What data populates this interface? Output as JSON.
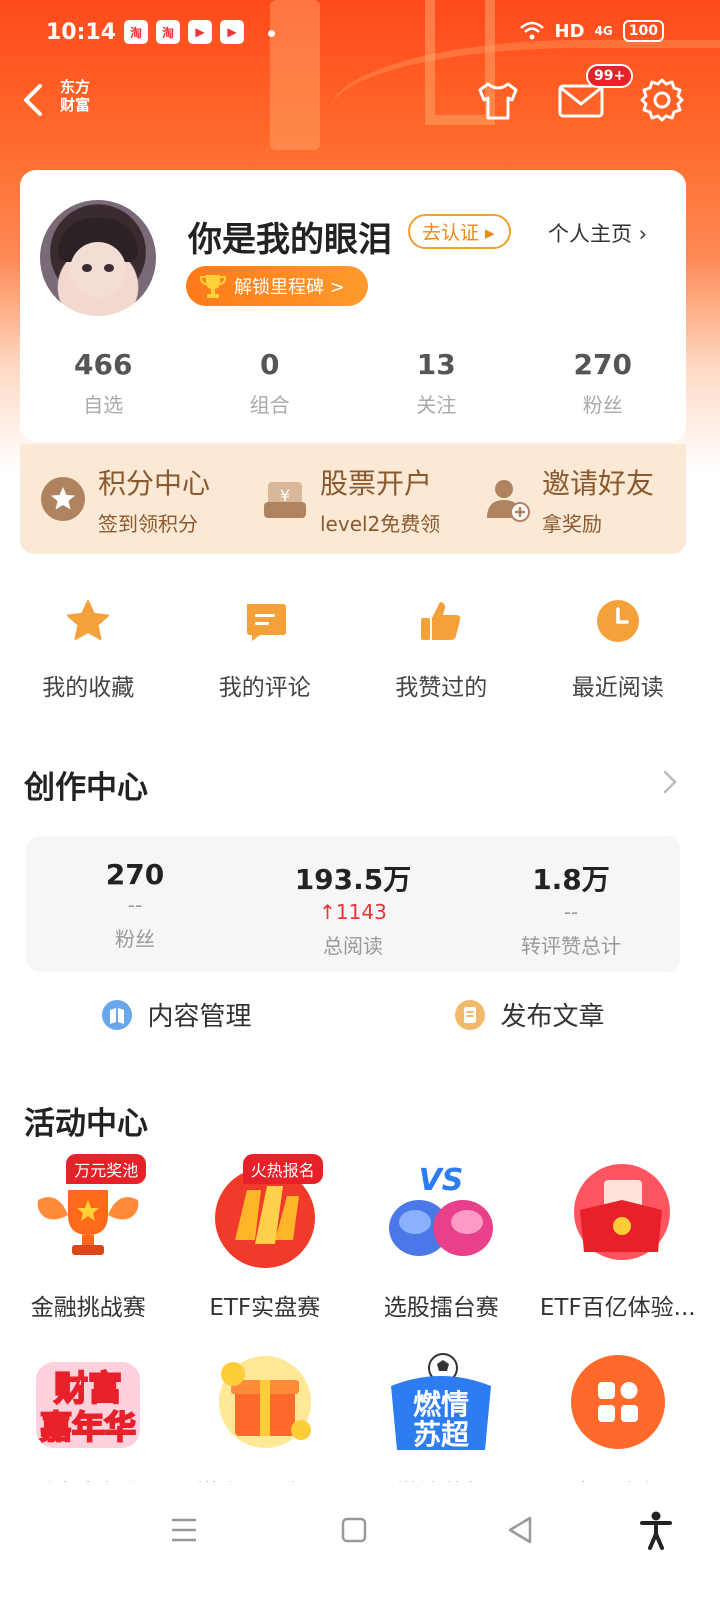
{
  "status_bar": {
    "time": "10:14",
    "app_icons": [
      "淘",
      "淘",
      "▶",
      "▶"
    ],
    "network": "HD",
    "signal": "4G",
    "battery": "100"
  },
  "nav": {
    "brand_line1": "东方",
    "brand_line2": "财富",
    "mail_badge": "99+"
  },
  "profile": {
    "username": "你是我的眼泪",
    "verify_label": "去认证 ▸",
    "homepage_label": "个人主页 ›",
    "milestone_label": "解锁里程碑 >",
    "stats": [
      {
        "value": "466",
        "label": "自选"
      },
      {
        "value": "0",
        "label": "组合"
      },
      {
        "value": "13",
        "label": "关注"
      },
      {
        "value": "270",
        "label": "粉丝"
      }
    ]
  },
  "promo": [
    {
      "title": "积分中心",
      "subtitle": "签到领积分"
    },
    {
      "title": "股票开户",
      "subtitle": "level2免费领"
    },
    {
      "title": "邀请好友",
      "subtitle": "拿奖励"
    }
  ],
  "quick": [
    {
      "label": "我的收藏"
    },
    {
      "label": "我的评论"
    },
    {
      "label": "我赞过的"
    },
    {
      "label": "最近阅读"
    }
  ],
  "creator": {
    "title": "创作中心",
    "stats": [
      {
        "value": "270",
        "delta": "--",
        "label": "粉丝"
      },
      {
        "value": "193.5万",
        "delta": "↑1143",
        "label": "总阅读"
      },
      {
        "value": "1.8万",
        "delta": "--",
        "label": "转评赞总计"
      }
    ],
    "actions": [
      {
        "label": "内容管理"
      },
      {
        "label": "发布文章"
      }
    ]
  },
  "activity": {
    "title": "活动中心",
    "row1": [
      {
        "label": "金融挑战赛",
        "tag": "万元奖池"
      },
      {
        "label": "ETF实盘赛",
        "tag": "火热报名"
      },
      {
        "label": "选股擂台赛",
        "tag": ""
      },
      {
        "label": "ETF百亿体验...",
        "tag": ""
      }
    ],
    "row2": [
      {
        "label": "财富嘉年华",
        "art_text": "财富嘉年华"
      },
      {
        "label": "攒金豆兑好礼",
        "art_text": ""
      },
      {
        "label": "燃情苏超",
        "art_text": "燃情苏超"
      },
      {
        "label": "查看全部",
        "art_text": ""
      }
    ]
  },
  "colors": {
    "brand_orange": "#ff5a1f",
    "badge_red": "#e8202a",
    "promo_bg": "#fbe9d6",
    "promo_text": "#8a5a2e",
    "icon_gold": "#f5a13a"
  }
}
